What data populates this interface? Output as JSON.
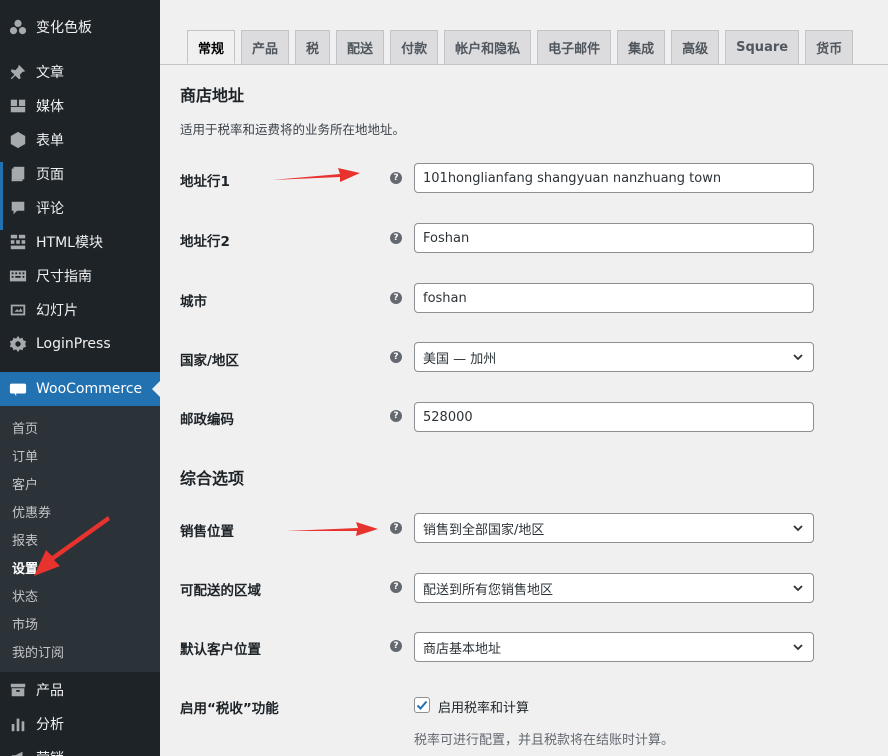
{
  "sidebar": {
    "items": [
      {
        "label": "变化色板",
        "icon": "groups-icon"
      },
      {
        "label": "文章",
        "icon": "pin-icon"
      },
      {
        "label": "媒体",
        "icon": "media-icon"
      },
      {
        "label": "表单",
        "icon": "forms-icon"
      },
      {
        "label": "页面",
        "icon": "page-icon"
      },
      {
        "label": "评论",
        "icon": "comment-icon"
      },
      {
        "label": "HTML模块",
        "icon": "grid-icon"
      },
      {
        "label": "尺寸指南",
        "icon": "keyboard-icon"
      },
      {
        "label": "幻灯片",
        "icon": "slides-icon"
      },
      {
        "label": "LoginPress",
        "icon": "gear-icon"
      },
      {
        "label": "WooCommerce",
        "icon": "woo-icon"
      },
      {
        "label": "产品",
        "icon": "archive-icon"
      },
      {
        "label": "分析",
        "icon": "bar-chart-icon"
      },
      {
        "label": "营销",
        "icon": "megaphone-icon"
      }
    ],
    "woo_submenu": [
      "首页",
      "订单",
      "客户",
      "优惠券",
      "报表",
      "设置",
      "状态",
      "市场",
      "我的订阅"
    ],
    "woo_submenu_active": "设置"
  },
  "tabs": [
    "常规",
    "产品",
    "税",
    "配送",
    "付款",
    "帐户和隐私",
    "电子邮件",
    "集成",
    "高级",
    "Square",
    "货币"
  ],
  "active_tab": "常规",
  "store_address": {
    "title": "商店地址",
    "description": "适用于税率和运费将的业务所在地地址。",
    "fields": [
      {
        "label": "地址行1",
        "value": "101honglianfang shangyuan nanzhuang town",
        "type": "text"
      },
      {
        "label": "地址行2",
        "value": "Foshan",
        "type": "text"
      },
      {
        "label": "城市",
        "value": "foshan",
        "type": "text"
      },
      {
        "label": "国家/地区",
        "value": "美国 — 加州",
        "type": "select"
      },
      {
        "label": "邮政编码",
        "value": "528000",
        "type": "text"
      }
    ]
  },
  "general_options": {
    "title": "综合选项",
    "fields": [
      {
        "label": "销售位置",
        "value": "销售到全部国家/地区",
        "type": "select"
      },
      {
        "label": "可配送的区域",
        "value": "配送到所有您销售地区",
        "type": "select"
      },
      {
        "label": "默认客户位置",
        "value": "商店基本地址",
        "type": "select"
      }
    ],
    "tax": {
      "label": "启用“税收”功能",
      "checkbox_label": "启用税率和计算",
      "checked": true,
      "help_text": "税率可进行配置，并且税款将在结账时计算。"
    }
  },
  "help_icon_glyph": "?",
  "colors": {
    "accent": "#2271b1",
    "sidebar": "#1d2327",
    "annotation_arrow": "#e8322e"
  }
}
